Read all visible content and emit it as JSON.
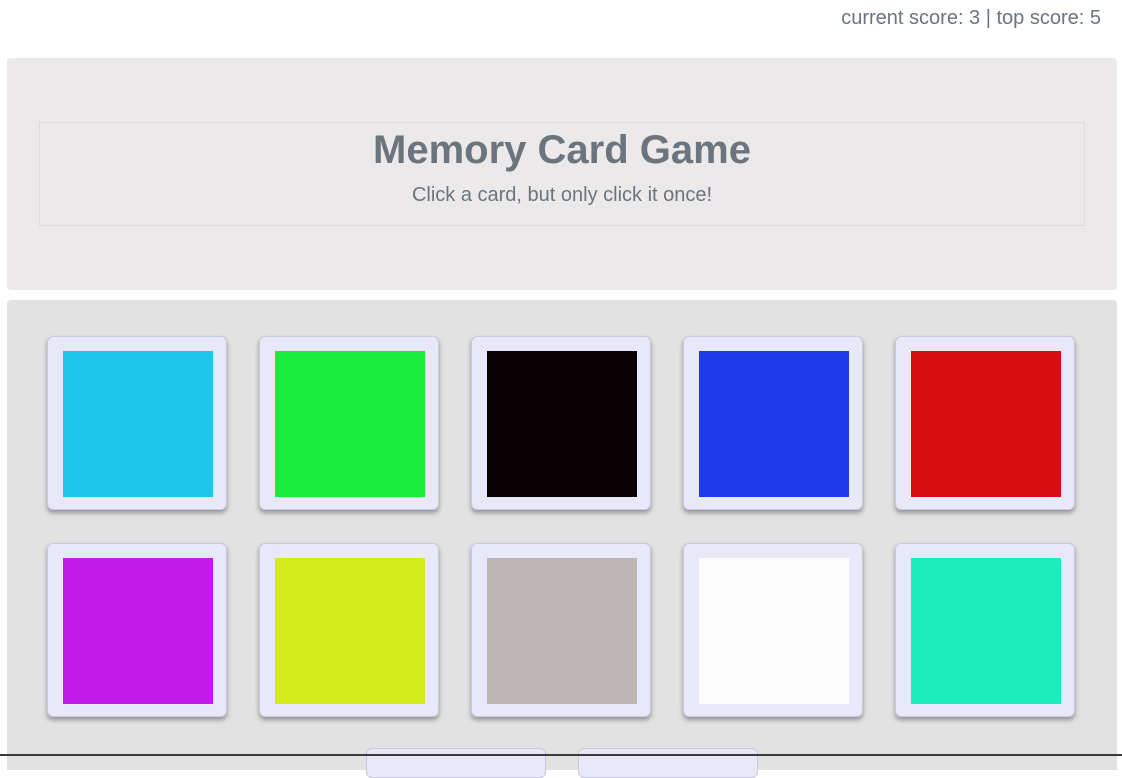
{
  "scoreboard": {
    "text": "current score: 3 | top score: 5",
    "current_score": 3,
    "top_score": 5
  },
  "header": {
    "title": "Memory Card Game",
    "subtitle": "Click a card, but only click it once!"
  },
  "cards": [
    {
      "color": "#1dc6ea"
    },
    {
      "color": "#1cec3e"
    },
    {
      "color": "#070103"
    },
    {
      "color": "#1d39ea"
    },
    {
      "color": "#d80f11"
    },
    {
      "color": "#c11cec"
    },
    {
      "color": "#d5ea1d"
    },
    {
      "color": "#bcb6b6"
    },
    {
      "color": "#fdfdfd"
    },
    {
      "color": "#1decbd"
    }
  ],
  "colors": {
    "header_bg": "#ebe9ea",
    "board_bg": "#e2e2e2",
    "card_bg": "#e8e8f8",
    "text": "#6c757d"
  }
}
